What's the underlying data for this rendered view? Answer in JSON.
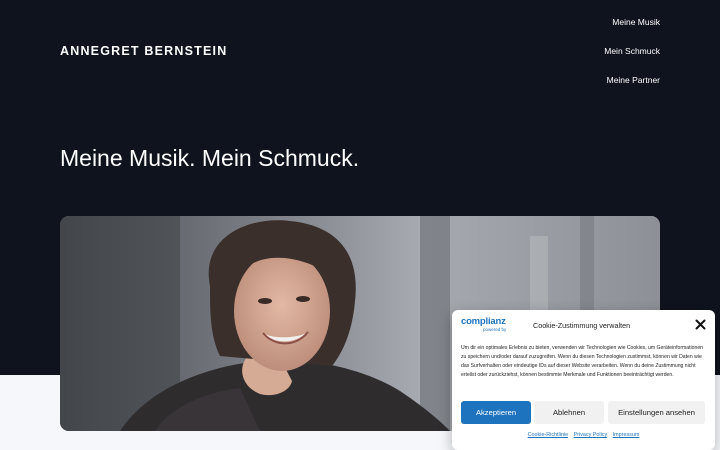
{
  "site": {
    "title": "ANNEGRET BERNSTEIN"
  },
  "nav": {
    "items": [
      "Meine Musik",
      "Mein Schmuck",
      "Meine Partner"
    ]
  },
  "hero": {
    "headline": "Meine Musik. Mein Schmuck."
  },
  "photo": {
    "subject": "portrait-photo"
  },
  "cookie": {
    "brand": "complianz",
    "brand_sub": "powered by",
    "title": "Cookie-Zustimmung verwalten",
    "text": "Um dir ein optimales Erlebnis zu bieten, verwenden wir Technologien wie Cookies, um Geräteinformationen zu speichern und/oder darauf zuzugreifen. Wenn du diesen Technologien zustimmst, können wir Daten wie das Surfverhalten oder eindeutige IDs auf dieser Website verarbeiten. Wenn du deine Zustimmung nicht erteilst oder zurückziehst, können bestimmte Merkmale und Funktionen beeinträchtigt werden.",
    "buttons": {
      "accept": "Akzeptieren",
      "deny": "Ablehnen",
      "settings": "Einstellungen ansehen"
    },
    "links": [
      "Cookie-Richtlinie",
      "Privacy Policy",
      "Impressum"
    ]
  },
  "colors": {
    "hero_bg": "#0f131d",
    "accent": "#1e73be",
    "page_bg": "#f6f7fb"
  }
}
